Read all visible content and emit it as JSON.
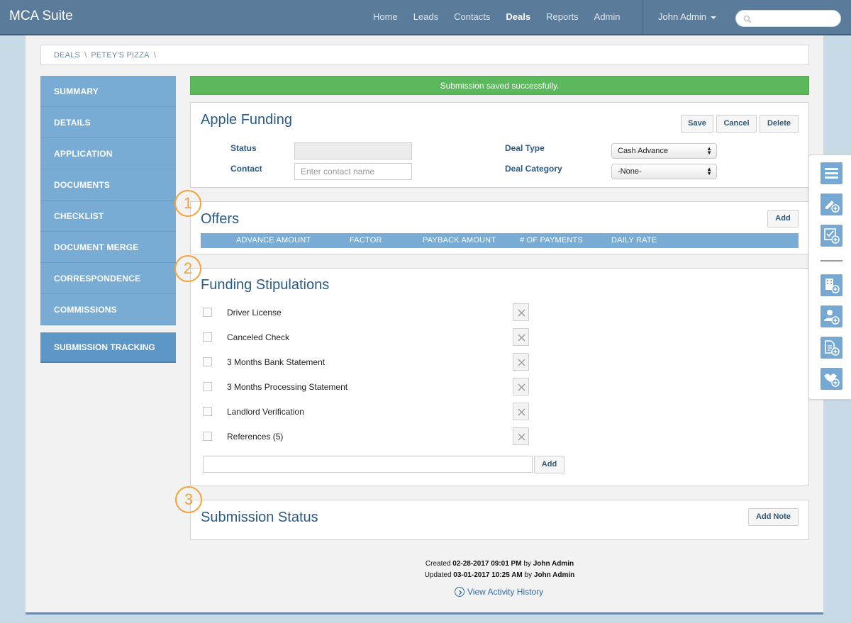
{
  "nav": {
    "brand": "MCA Suite",
    "links": [
      "Home",
      "Leads",
      "Contacts",
      "Deals",
      "Reports",
      "Admin"
    ],
    "active": "Deals",
    "user": "John Admin"
  },
  "breadcrumb": [
    "DEALS",
    "PETEY'S PIZZA"
  ],
  "sidebar": {
    "items": [
      "SUMMARY",
      "DETAILS",
      "APPLICATION",
      "DOCUMENTS",
      "CHECKLIST",
      "DOCUMENT MERGE",
      "CORRESPONDENCE",
      "COMMISSIONS"
    ],
    "tracking": "SUBMISSION TRACKING"
  },
  "alert": "Submission saved successfully.",
  "submission": {
    "title": "Apple Funding",
    "save": "Save",
    "cancel": "Cancel",
    "delete": "Delete",
    "status_label": "Status",
    "contact_label": "Contact",
    "contact_placeholder": "Enter contact name",
    "deal_type_label": "Deal Type",
    "deal_type_value": "Cash Advance",
    "deal_category_label": "Deal Category",
    "deal_category_value": "-None-"
  },
  "offers": {
    "title": "Offers",
    "add": "Add",
    "columns": [
      "ADVANCE AMOUNT",
      "FACTOR",
      "PAYBACK AMOUNT",
      "# OF PAYMENTS",
      "DAILY RATE"
    ]
  },
  "stipulations": {
    "title": "Funding Stipulations",
    "items": [
      "Driver License",
      "Canceled Check",
      "3 Months Bank Statement",
      "3 Months Processing Statement",
      "Landlord Verification",
      "References (5)"
    ],
    "add": "Add"
  },
  "status_panel": {
    "title": "Submission Status",
    "add_note": "Add Note"
  },
  "markers": [
    "1",
    "2",
    "3"
  ],
  "footer": {
    "created_prefix": "Created",
    "created_date": "02-28-2017 09:01 PM",
    "created_by_word": "by",
    "created_by": "John Admin",
    "updated_prefix": "Updated",
    "updated_date": "03-01-2017 10:25 AM",
    "updated_by_word": "by",
    "updated_by": "John Admin",
    "history": "View Activity History"
  },
  "quickbar_icons": [
    "list-icon",
    "edit-add-icon",
    "checklist-add-icon",
    "building-add-icon",
    "user-add-icon",
    "document-add-icon",
    "handshake-add-icon"
  ],
  "colors": {
    "nav": "#5a7b9a",
    "sidebar": "#78acd4",
    "accent": "#2a5b86",
    "success": "#5cb85c",
    "marker": "#f3a23a"
  }
}
